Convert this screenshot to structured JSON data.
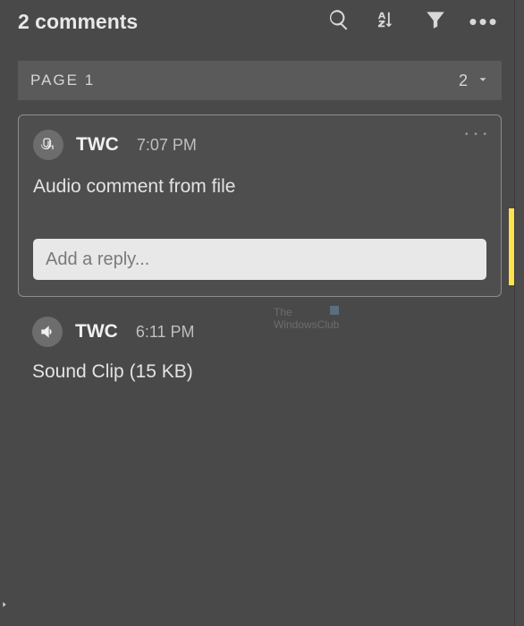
{
  "header": {
    "title": "2 comments"
  },
  "page_group": {
    "label": "PAGE 1",
    "count": "2"
  },
  "comments": [
    {
      "author": "TWC",
      "time": "7:07 PM",
      "body": "Audio comment from file",
      "icon": "attachment-comment-icon",
      "reply_placeholder": "Add a reply..."
    },
    {
      "author": "TWC",
      "time": "6:11 PM",
      "body": "Sound Clip (15 KB)",
      "icon": "speaker-icon"
    }
  ],
  "watermark": {
    "line1": "The",
    "line2": "WindowsClub"
  },
  "accent_color": "#ffe34d"
}
